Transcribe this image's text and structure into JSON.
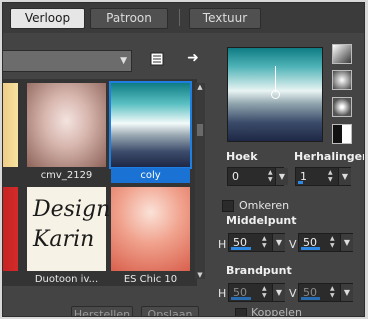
{
  "tabs": [
    {
      "label": "Verloop",
      "active": true
    },
    {
      "label": "Patroon",
      "active": false
    },
    {
      "label": "Textuur",
      "active": false
    }
  ],
  "preset_select": {
    "value": ""
  },
  "gallery": {
    "items": [
      {
        "caption": "cmv_2129",
        "selected": false
      },
      {
        "caption": "coly",
        "selected": true
      },
      {
        "caption": "Duotoon iv...",
        "selected": false
      },
      {
        "caption": "ES Chic 10",
        "selected": false
      }
    ],
    "watermark": "Design Karin"
  },
  "angle": {
    "label": "Hoek",
    "value": "0"
  },
  "repeats": {
    "label": "Herhalingen",
    "value": "1"
  },
  "invert": {
    "label": "Omkeren",
    "checked": false
  },
  "center_point": {
    "label": "Middelpunt",
    "h_label": "H",
    "h_value": "50",
    "v_label": "V",
    "v_value": "50"
  },
  "focal_point": {
    "label": "Brandpunt",
    "h_label": "H",
    "h_value": "50",
    "v_label": "V",
    "v_value": "50"
  },
  "link": {
    "label": "Koppelen",
    "checked": false
  },
  "buttons": {
    "reset": "Herstellen",
    "save": "Opslaan"
  },
  "colors": {
    "accent": "#1f7fe0",
    "panel": "#444444"
  }
}
